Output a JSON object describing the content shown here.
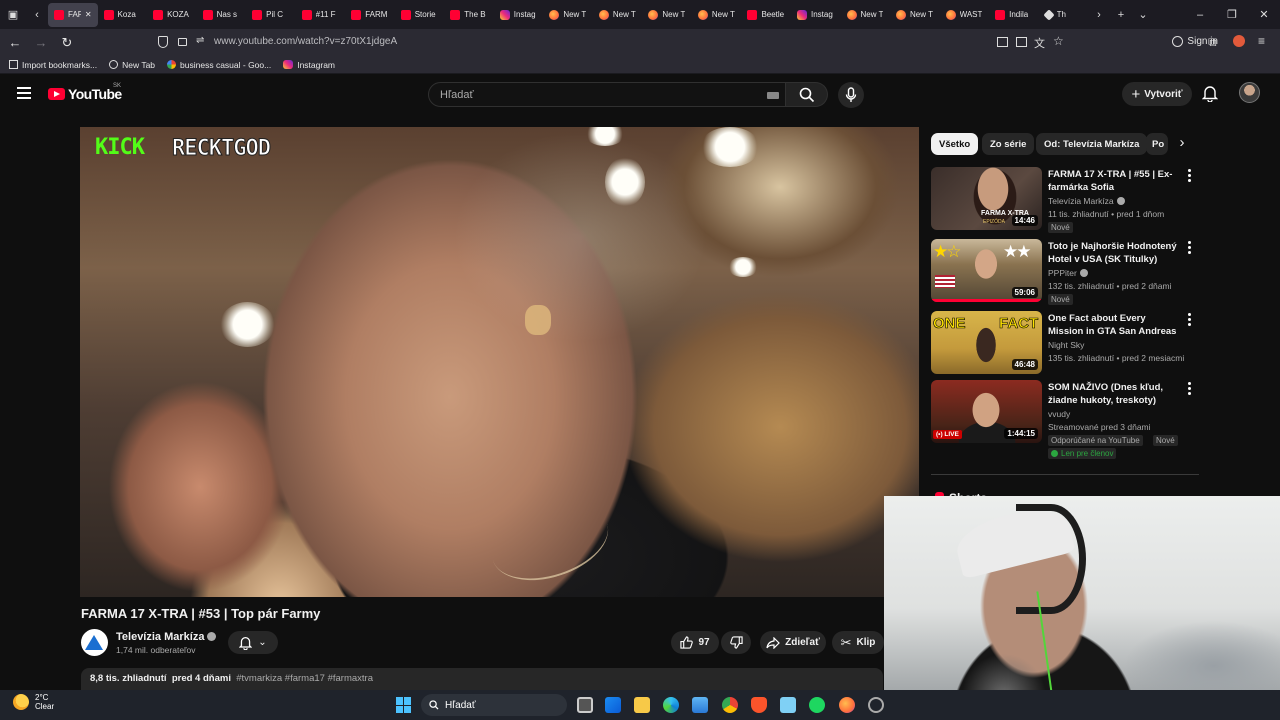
{
  "browser": {
    "tabs": [
      {
        "label": "FARMA",
        "icon": "yt",
        "active": true
      },
      {
        "label": "Koza",
        "icon": "yt"
      },
      {
        "label": "KOZA",
        "icon": "yt"
      },
      {
        "label": "Nas s",
        "icon": "yt"
      },
      {
        "label": "Pil C",
        "icon": "yt"
      },
      {
        "label": "#11 F",
        "icon": "yt"
      },
      {
        "label": "FARM",
        "icon": "yt"
      },
      {
        "label": "Storie",
        "icon": "yt"
      },
      {
        "label": "The B",
        "icon": "yt"
      },
      {
        "label": "Instag",
        "icon": "ig"
      },
      {
        "label": "New T",
        "icon": "ff"
      },
      {
        "label": "New T",
        "icon": "ff"
      },
      {
        "label": "New T",
        "icon": "ff"
      },
      {
        "label": "New T",
        "icon": "ff"
      },
      {
        "label": "Beetle",
        "icon": "yt"
      },
      {
        "label": "Instag",
        "icon": "ig"
      },
      {
        "label": "New T",
        "icon": "ff"
      },
      {
        "label": "New T",
        "icon": "ff"
      },
      {
        "label": "WAST",
        "icon": "ff"
      },
      {
        "label": "Indila",
        "icon": "yt"
      },
      {
        "label": "Th",
        "icon": "kd"
      }
    ],
    "url": "www.youtube.com/watch?v=z70tX1jdgeA",
    "sign_in": "Sign in",
    "bookmarks": [
      {
        "label": "Import bookmarks...",
        "icon": "import-icon"
      },
      {
        "label": "New Tab",
        "icon": "globe-icon"
      },
      {
        "label": "business casual - Goo...",
        "icon": "google-icon"
      },
      {
        "label": "Instagram",
        "icon": "instagram-icon"
      }
    ]
  },
  "youtube": {
    "logo_text": "YouTube",
    "region": "SK",
    "search_placeholder": "Hľadať",
    "create_label": "Vytvoriť"
  },
  "video": {
    "overlay_kick": "KICK",
    "overlay_name": "RECKTGOD",
    "title": "FARMA 17 X-TRA | #53 | Top pár Farmy",
    "channel": "Televízia Markíza",
    "subscribers": "1,74 mil. odberateľov",
    "likes": "97",
    "share_label": "Zdieľať",
    "clip_label": "Klip",
    "views": "8,8 tis. zhliadnutí",
    "age": "pred 4 dňami",
    "hashtags": "#tvmarkiza #farma17 #farmaxtra"
  },
  "sidebar": {
    "chips": [
      "Všetko",
      "Zo série",
      "Od: Televízia Markíza",
      "Po"
    ],
    "recommendations": [
      {
        "title": "FARMA 17 X-TRA | #55 | Ex-farmárka Sofia",
        "channel": "Televízia Markíza",
        "verified": true,
        "meta": "11 tis. zhliadnutí • pred 1 dňom",
        "duration": "14:46",
        "badge": "Nové"
      },
      {
        "title": "Toto je Najhoršie Hodnotený Hotel v USA (SK Titulky)",
        "channel": "PPPiter",
        "verified": true,
        "meta": "132 tis. zhliadnutí • pred 2 dňami",
        "duration": "59:06",
        "badge": "Nové"
      },
      {
        "title": "One Fact about Every Mission in GTA San Andreas",
        "channel": "Night Sky",
        "verified": false,
        "meta": "135 tis. zhliadnutí • pred 2 mesiacmi",
        "duration": "46:48",
        "badge": ""
      },
      {
        "title": "SOM NAŽIVO (Dnes kľud, žiadne hukoty, treskoty)",
        "channel": "vvudy",
        "verified": false,
        "meta": "Streamované pred 3 dňami",
        "duration": "1:44:15",
        "badge": "Odporúčané na YouTube",
        "badge2": "Nové",
        "members": "Len pre členov",
        "live_label": "(•) LIVE"
      }
    ],
    "thumb_texts": {
      "farma": "FARMA X-TRA",
      "epizoda": "EPIZÓDA",
      "one": "ONE",
      "fact": "FACT"
    },
    "shorts_heading": "Shorts"
  },
  "taskbar": {
    "temperature": "2°C",
    "condition": "Clear",
    "search_label": "Hľadať"
  },
  "colors": {
    "youtube_red": "#ff0033",
    "kick_green": "#53fc18",
    "page_bg": "#0f0f0f",
    "chip_selected_bg": "#f1f1f1"
  }
}
